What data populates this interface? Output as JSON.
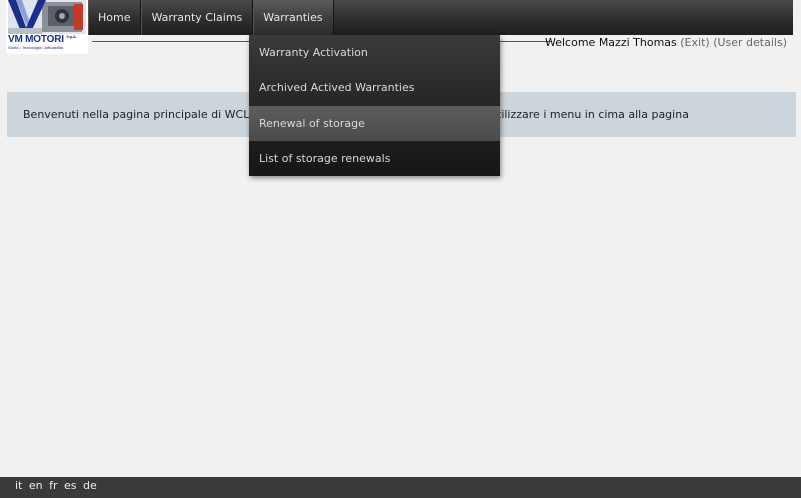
{
  "logo": {
    "name": "VM MOTORI",
    "suffix": "S.p.A.",
    "tagline": "Storia • Tecnologia • Affidabilità"
  },
  "nav": {
    "items": [
      {
        "label": "Home"
      },
      {
        "label": "Warranty Claims"
      },
      {
        "label": "Warranties"
      }
    ],
    "active_index": 2
  },
  "header": {
    "welcome_prefix": "Welcome",
    "user_name": "Mazzi Thomas",
    "exit_label": "(Exit)",
    "user_details_label": "(User details)"
  },
  "banner": {
    "text_visible_left": "Benvenuti nella pagina principale di WCL: p",
    "text_visible_right": "tilizzare i menu in cima alla pagina"
  },
  "dropdown": {
    "items": [
      {
        "label": "Warranty Activation"
      },
      {
        "label": "Archived Actived Warranties"
      },
      {
        "label": "Renewal of storage"
      },
      {
        "label": "List of storage renewals"
      }
    ],
    "hover_index": 2
  },
  "footer": {
    "languages": [
      "it",
      "en",
      "fr",
      "es",
      "de"
    ]
  },
  "colors": {
    "page_bg": "#f1f1f1",
    "banner_bg": "#cdd5dc",
    "nav_bg": "#2e2e2e",
    "footer_bg": "#3a3a3a",
    "logo_blue": "#1b2f8a"
  }
}
